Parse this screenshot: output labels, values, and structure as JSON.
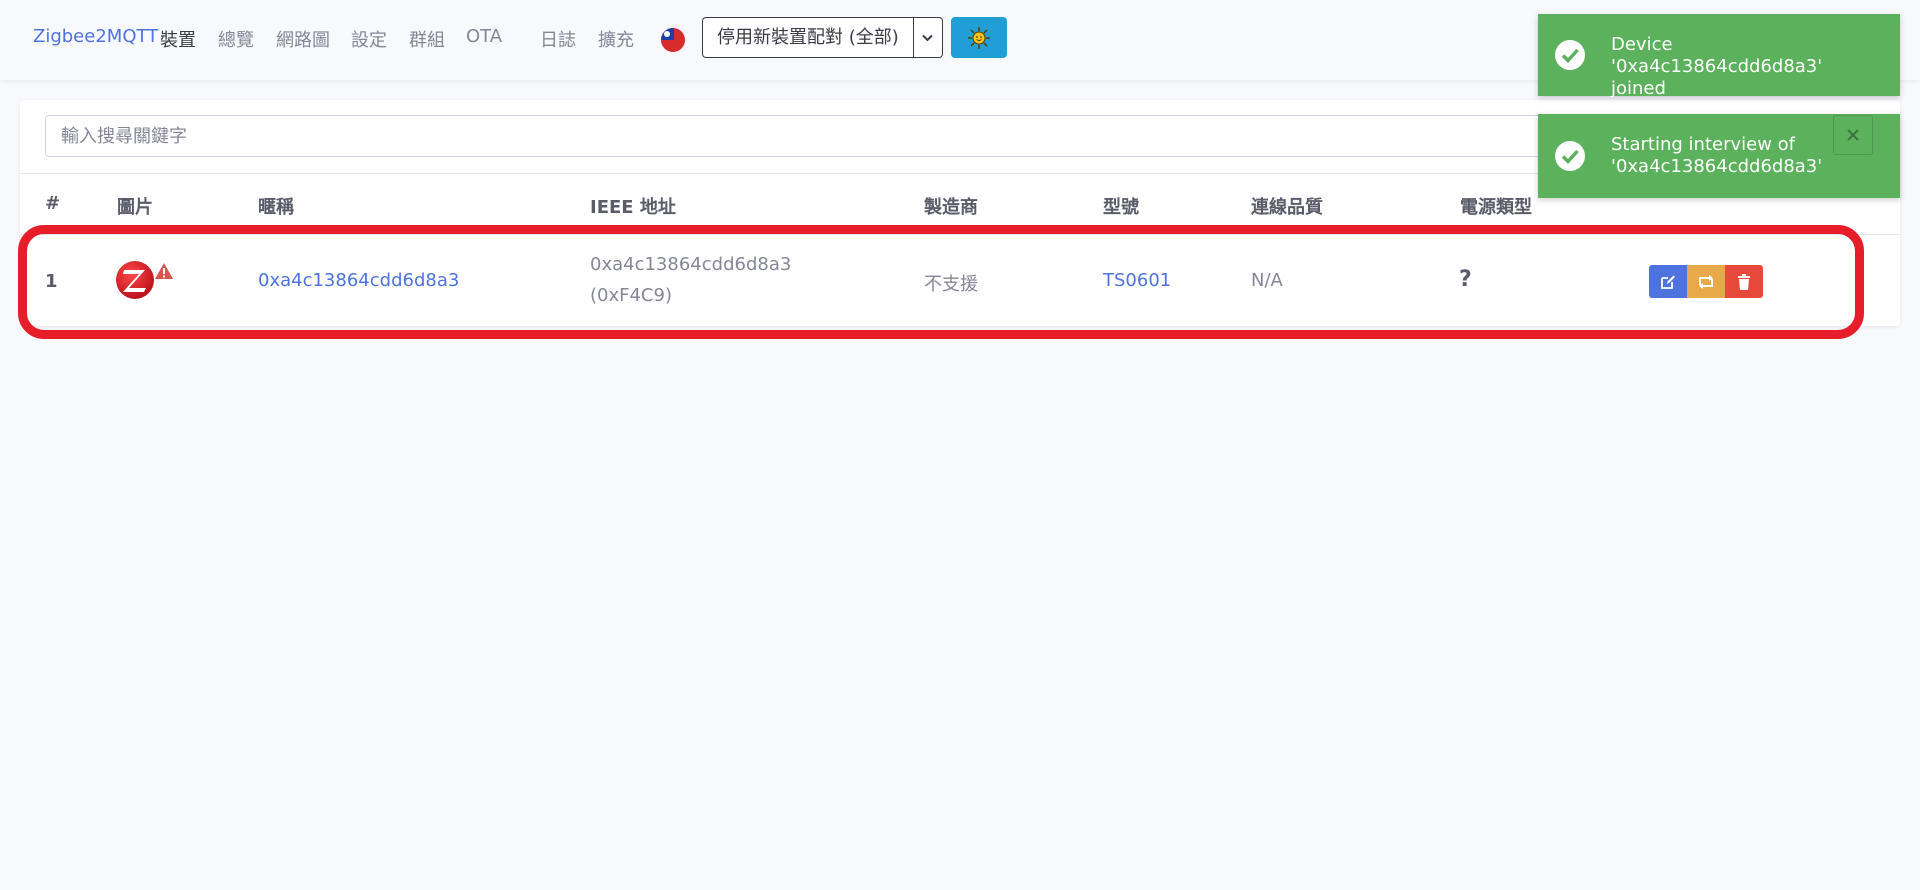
{
  "nav": {
    "brand": "Zigbee2MQTT",
    "items": [
      "裝置",
      "總覽",
      "網路圖",
      "設定",
      "群組",
      "OTA",
      "日誌",
      "擴充"
    ],
    "active_item": "裝置",
    "language_flag": "taiwan-flag-icon",
    "permit_join_label": "停用新裝置配對 (全部)",
    "theme_icon": "sun-icon"
  },
  "devices": {
    "search_placeholder": "輸入搜尋關鍵字",
    "columns": [
      "#",
      "圖片",
      "暱稱",
      "IEEE 地址",
      "製造商",
      "型號",
      "連線品質",
      "電源類型"
    ],
    "rows": [
      {
        "index": "1",
        "image_icon": "zigbee-logo-icon",
        "warning_icon": "warning-icon",
        "friendly_name": "0xa4c13864cdd6d8a3",
        "ieee_address": "0xa4c13864cdd6d8a3",
        "network_address": "(0xF4C9)",
        "manufacturer": "不支援",
        "model": "TS0601",
        "lqi": "N/A",
        "power_source": "?"
      }
    ],
    "action_icons": [
      "edit-icon",
      "rename-icon",
      "trash-icon"
    ]
  },
  "toasts": [
    {
      "icon": "check-circle-icon",
      "message": "Device '0xa4c13864cdd6d8a3' joined"
    },
    {
      "icon": "check-circle-icon",
      "message": "Starting interview of '0xa4c13864cdd6d8a3'"
    }
  ],
  "colors": {
    "primary": "#4e73df",
    "highlight": "#e81d2a",
    "toast_success": "#5cb25c",
    "rename": "#e8a94a",
    "danger": "#e74a3b",
    "theme_button": "#1f9fd6"
  }
}
